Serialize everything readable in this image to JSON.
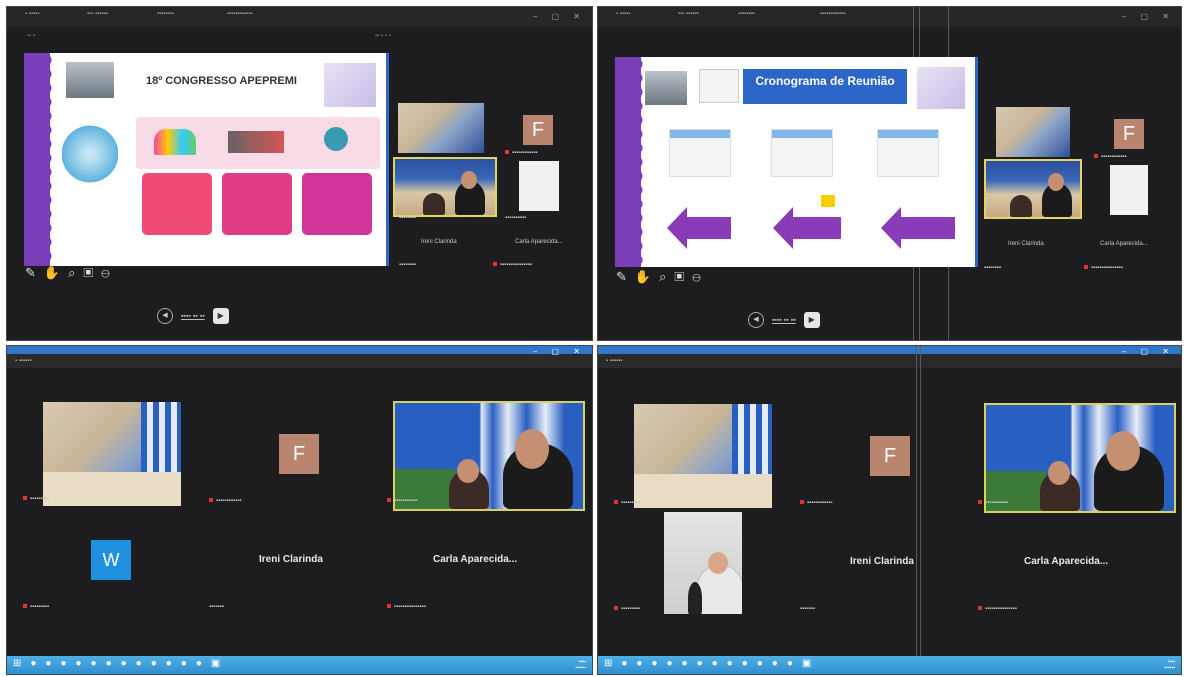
{
  "q1": {
    "slide_title": "18º CONGRESSO APEPREMI",
    "participants": [
      {
        "name": "Ireni Clarinda"
      },
      {
        "name": "Carla Aparecida..."
      }
    ],
    "nav_icons": [
      "pen-icon",
      "hand-icon",
      "zoom-icon",
      "screen-icon",
      "more-icon"
    ],
    "avatar_letter": "F"
  },
  "q2": {
    "slide_title": "Cronograma de Reunião",
    "participants": [
      {
        "name": "Ireni Clarinda"
      },
      {
        "name": "Carla Aparecida..."
      }
    ],
    "avatar_letter": "F"
  },
  "q3": {
    "avatar_f": "F",
    "avatar_w": "W",
    "participant_1": "Ireni Clarinda",
    "participant_2": "Carla Aparecida..."
  },
  "q4": {
    "avatar_f": "F",
    "participant_1": "Ireni Clarinda",
    "participant_2": "Carla Aparecida..."
  },
  "colors": {
    "panel_bg": "#1d1d1f",
    "taskbar": "#2f8fd0",
    "purple": "#7a3db8",
    "pink": "#f04a77",
    "magenta": "#d8358f",
    "blue_header": "#2c66c9",
    "avatar_f": "#b9856e",
    "avatar_w": "#1f8fe0"
  }
}
